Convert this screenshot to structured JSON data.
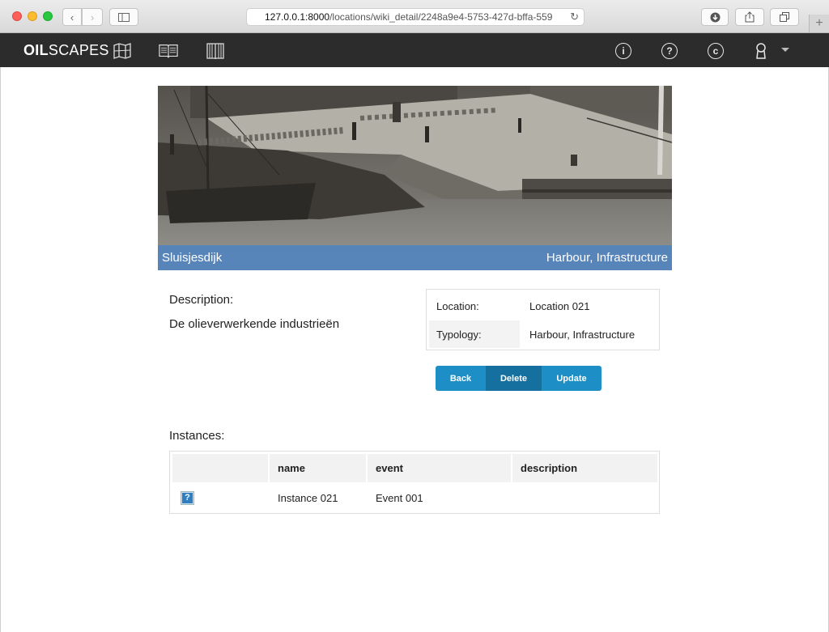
{
  "browser": {
    "url_host": "127.0.0.1:8000",
    "url_path": "/locations/wiki_detail/2248a9e4-5753-427d-bffa-559",
    "new_tab_symbol": "+"
  },
  "navbar": {
    "brand_bold": "OIL",
    "brand_rest": "SCAPES",
    "info_symbol": "i",
    "help_symbol": "?",
    "copyright_symbol": "c"
  },
  "hero": {
    "name": "Sluisjesdijk",
    "typology": "Harbour, Infrastructure"
  },
  "description": {
    "label": "Description:",
    "text": "De olieverwerkende industrieën"
  },
  "details": [
    {
      "key": "Location:",
      "value": "Location 021"
    },
    {
      "key": "Typology:",
      "value": "Harbour, Infrastructure"
    }
  ],
  "actions": {
    "back": "Back",
    "delete": "Delete",
    "update": "Update"
  },
  "instances": {
    "label": "Instances:",
    "columns": [
      "",
      "name",
      "event",
      "description"
    ],
    "rows": [
      {
        "icon": "help-icon",
        "icon_symbol": "?",
        "name": "Instance 021",
        "event": "Event 001",
        "description": ""
      }
    ]
  },
  "colors": {
    "navbar_bg": "#2c2c2c",
    "caption_bg": "#5384be",
    "button_primary": "#1e8fc6",
    "button_active": "#16709f"
  }
}
